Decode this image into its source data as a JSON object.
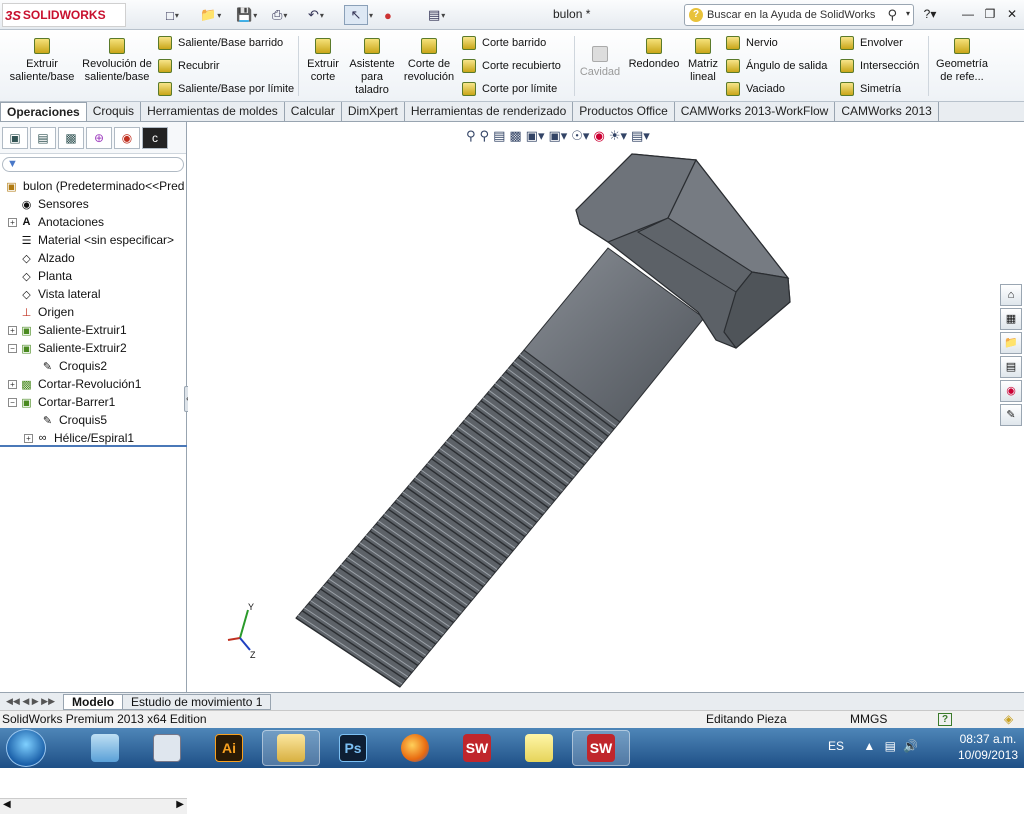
{
  "app": {
    "logo_text": "SOLIDWORKS",
    "document_title": "bulon *",
    "help_search_placeholder": "Buscar en la Ayuda de SolidWorks"
  },
  "ribbon": {
    "big_buttons": [
      {
        "label": "Extruir saliente/base",
        "icon": "extrude-boss-icon"
      },
      {
        "label": "Revolución de saliente/base",
        "icon": "revolve-boss-icon"
      },
      {
        "label": "Extruir corte",
        "icon": "extrude-cut-icon"
      },
      {
        "label": "Asistente para taladro",
        "icon": "hole-wizard-icon"
      },
      {
        "label": "Corte de revolución",
        "icon": "revolve-cut-icon"
      },
      {
        "label": "Cavidad",
        "icon": "cavity-icon",
        "disabled": true
      },
      {
        "label": "Redondeo",
        "icon": "fillet-icon"
      },
      {
        "label": "Matriz lineal",
        "icon": "linear-pattern-icon"
      },
      {
        "label": "Geometría de refe...",
        "icon": "reference-geometry-icon"
      }
    ],
    "small_buttons": [
      {
        "label": "Saliente/Base barrido",
        "icon": "swept-boss-icon"
      },
      {
        "label": "Recubrir",
        "icon": "loft-icon"
      },
      {
        "label": "Saliente/Base por límite",
        "icon": "boundary-boss-icon"
      },
      {
        "label": "Corte barrido",
        "icon": "swept-cut-icon"
      },
      {
        "label": "Corte recubierto",
        "icon": "lofted-cut-icon"
      },
      {
        "label": "Corte por límite",
        "icon": "boundary-cut-icon"
      },
      {
        "label": "Nervio",
        "icon": "rib-icon"
      },
      {
        "label": "Ángulo de salida",
        "icon": "draft-icon"
      },
      {
        "label": "Vaciado",
        "icon": "shell-icon"
      },
      {
        "label": "Envolver",
        "icon": "wrap-icon"
      },
      {
        "label": "Intersección",
        "icon": "intersect-icon"
      },
      {
        "label": "Simetría",
        "icon": "mirror-icon"
      }
    ]
  },
  "tabs": [
    "Operaciones",
    "Croquis",
    "Herramientas de moldes",
    "Calcular",
    "DimXpert",
    "Herramientas de renderizado",
    "Productos Office",
    "CAMWorks 2013-WorkFlow",
    "CAMWorks 2013"
  ],
  "feature_tree": {
    "root": "bulon  (Predeterminado<<Pred",
    "items": [
      {
        "label": "Sensores",
        "icon": "sensor-icon",
        "level": 1,
        "expandable": false
      },
      {
        "label": "Anotaciones",
        "icon": "annotation-icon",
        "level": 1,
        "expandable": true
      },
      {
        "label": "Material <sin especificar>",
        "icon": "material-icon",
        "level": 1,
        "expandable": false
      },
      {
        "label": "Alzado",
        "icon": "plane-icon",
        "level": 1,
        "expandable": false
      },
      {
        "label": "Planta",
        "icon": "plane-icon",
        "level": 1,
        "expandable": false
      },
      {
        "label": "Vista lateral",
        "icon": "plane-icon",
        "level": 1,
        "expandable": false
      },
      {
        "label": "Origen",
        "icon": "origin-icon",
        "level": 1,
        "expandable": false
      },
      {
        "label": "Saliente-Extruir1",
        "icon": "extrude-feature-icon",
        "level": 1,
        "expandable": true
      },
      {
        "label": "Saliente-Extruir2",
        "icon": "extrude-feature-icon",
        "level": 1,
        "expandable": true,
        "expanded": true
      },
      {
        "label": "Croquis2",
        "icon": "sketch-icon",
        "level": 2,
        "expandable": false
      },
      {
        "label": "Cortar-Revolución1",
        "icon": "revolve-cut-feature-icon",
        "level": 1,
        "expandable": true
      },
      {
        "label": "Cortar-Barrer1",
        "icon": "swept-cut-feature-icon",
        "level": 1,
        "expandable": true,
        "expanded": true
      },
      {
        "label": "Croquis5",
        "icon": "sketch-icon",
        "level": 2,
        "expandable": false
      },
      {
        "label": "Hélice/Espiral1",
        "icon": "helix-icon",
        "level": 2,
        "expandable": true
      }
    ]
  },
  "bottom_tabs": [
    "Modelo",
    "Estudio de movimiento 1"
  ],
  "status_bar": {
    "edition": "SolidWorks Premium 2013 x64 Edition",
    "mode": "Editando Pieza",
    "units": "MMGS"
  },
  "taskbar": {
    "apps": [
      {
        "name": "Mathematica",
        "icon": "mathematica-icon"
      },
      {
        "name": "Calculator",
        "icon": "calculator-icon"
      },
      {
        "name": "Ai",
        "icon": "illustrator-icon",
        "text": "Ai",
        "color": "#b35a00"
      },
      {
        "name": "Explorer",
        "icon": "folder-icon",
        "open": true
      },
      {
        "name": "Ps",
        "icon": "photoshop-icon",
        "text": "Ps",
        "color": "#1b4f8a"
      },
      {
        "name": "Firefox",
        "icon": "firefox-icon"
      },
      {
        "name": "SW",
        "icon": "solidworks-icon",
        "text": "SW",
        "color": "#c0262c"
      },
      {
        "name": "Sticky Notes",
        "icon": "sticky-notes-icon"
      },
      {
        "name": "SW",
        "icon": "solidworks-icon",
        "text": "SW",
        "color": "#c0262c",
        "open": true
      }
    ],
    "language": "ES",
    "time": "08:37 a.m.",
    "date": "10/09/2013"
  },
  "triad_labels": {
    "y": "Y",
    "z": "Z"
  }
}
